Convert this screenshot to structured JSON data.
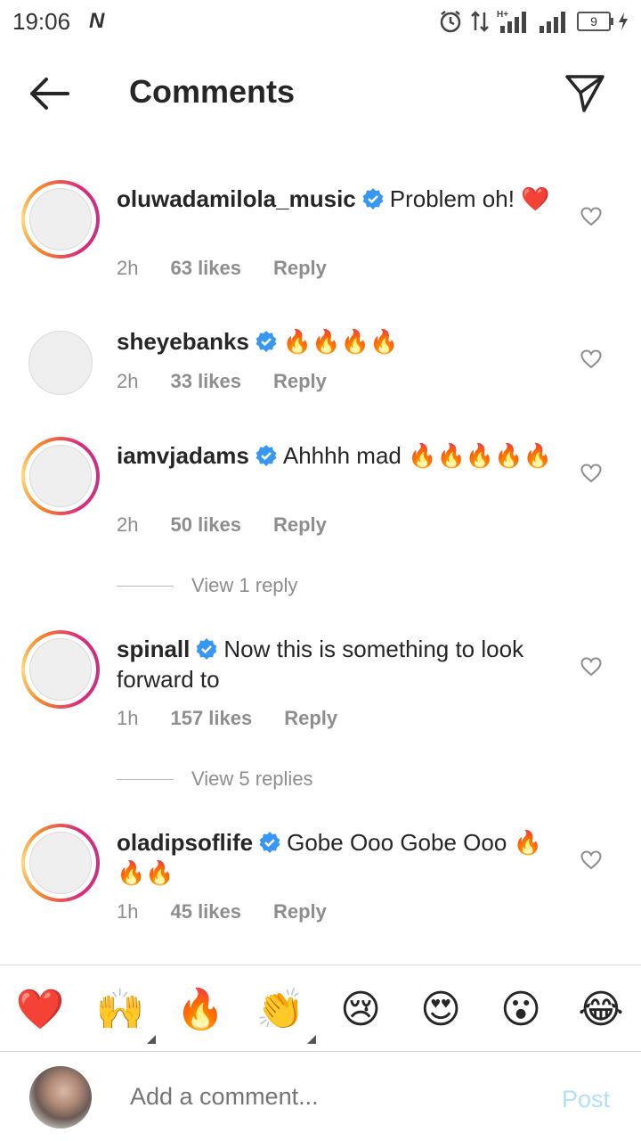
{
  "status_bar": {
    "time": "19:06",
    "carrier_logo": "N",
    "battery": "9",
    "network": "H+"
  },
  "header": {
    "title": "Comments"
  },
  "comments": [
    {
      "username": "oluwadamilola_music",
      "text": "Problem oh! ❤️",
      "time": "2h",
      "likes": "63 likes",
      "reply": "Reply",
      "ring": true
    },
    {
      "username": "sheyebanks",
      "text": "🔥🔥🔥🔥",
      "time": "2h",
      "likes": "33 likes",
      "reply": "Reply",
      "ring": false
    },
    {
      "username": "iamvjadams",
      "text": "Ahhhh mad 🔥🔥🔥🔥🔥",
      "time": "2h",
      "likes": "50 likes",
      "reply": "Reply",
      "ring": true
    },
    {
      "username": "spinall",
      "text": "Now this is something to look forward to",
      "time": "1h",
      "likes": "157 likes",
      "reply": "Reply",
      "ring": true
    },
    {
      "username": "oladipsoflife",
      "text": "Gobe Ooo Gobe Ooo 🔥🔥🔥",
      "time": "1h",
      "likes": "45 likes",
      "reply": "Reply",
      "ring": true
    }
  ],
  "view_replies": [
    {
      "label": "View 1 reply"
    },
    {
      "label": "View 5 replies"
    }
  ],
  "emoji_bar": [
    "❤️",
    "🙌",
    "🔥",
    "👏",
    "😢",
    "😍",
    "😮",
    "😂"
  ],
  "add_comment": {
    "placeholder": "Add a comment...",
    "post_label": "Post"
  },
  "colors": {
    "verified": "#3897f0",
    "post_disabled": "#b2dffc",
    "meta_grey": "#8e8e8e"
  }
}
